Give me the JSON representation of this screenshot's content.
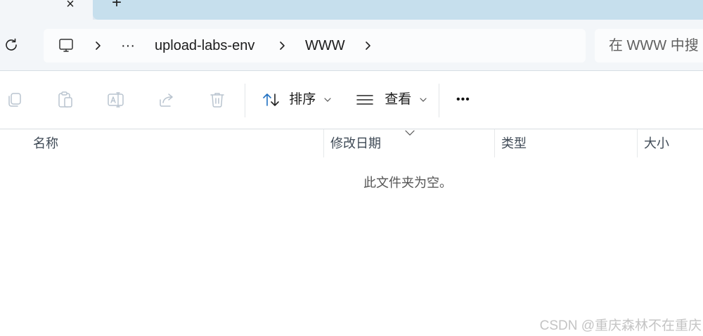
{
  "window": {
    "new_tab_label": "+",
    "tab_close_label": "×"
  },
  "address_bar": {
    "crumbs": [
      "···",
      "upload-labs-env",
      "WWW"
    ]
  },
  "search": {
    "placeholder": "在 WWW 中搜"
  },
  "toolbar": {
    "sort_label": "排序",
    "view_label": "查看",
    "more_label": "•••"
  },
  "columns": [
    "名称",
    "修改日期",
    "类型",
    "大小"
  ],
  "content": {
    "empty_message": "此文件夹为空。"
  },
  "watermark": "CSDN @重庆森林不在重庆",
  "colors": {
    "tab_strip": "#dfe9f1",
    "tab_inactive": "#c6dfed",
    "nav_bg": "#f3f6f9",
    "accent": "#1f6fc1"
  }
}
